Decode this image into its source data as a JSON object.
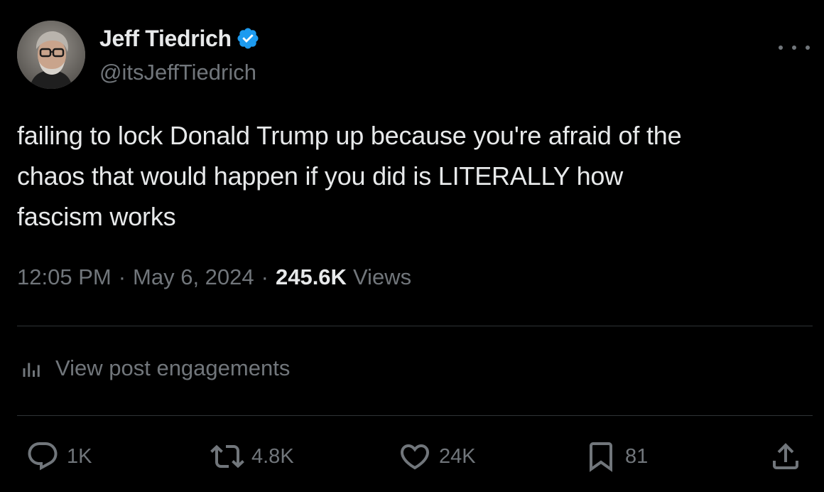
{
  "author": {
    "display_name": "Jeff Tiedrich",
    "handle": "@itsJeffTiedrich",
    "verified": true,
    "verified_color": "#1d9bf0"
  },
  "post": {
    "text": "failing to lock Donald Trump up because you're afraid of the\nchaos that would happen if you did is LITERALLY how\nfascism works",
    "time": "12:05 PM",
    "separator": "·",
    "date": "May 6, 2024",
    "views_count": "245.6K",
    "views_label": "Views"
  },
  "engagements": {
    "label": "View post engagements",
    "icon": "bar-chart-icon"
  },
  "actions": {
    "reply": {
      "icon": "reply-icon",
      "count": "1K"
    },
    "repost": {
      "icon": "repost-icon",
      "count": "4.8K"
    },
    "like": {
      "icon": "heart-icon",
      "count": "24K"
    },
    "bookmark": {
      "icon": "bookmark-icon",
      "count": "81"
    },
    "share": {
      "icon": "share-icon"
    }
  },
  "more_icon": "more-dots-icon",
  "colors": {
    "background": "#000000",
    "text_primary": "#e7e9ea",
    "text_secondary": "#71767b",
    "divider": "#2f3336"
  }
}
